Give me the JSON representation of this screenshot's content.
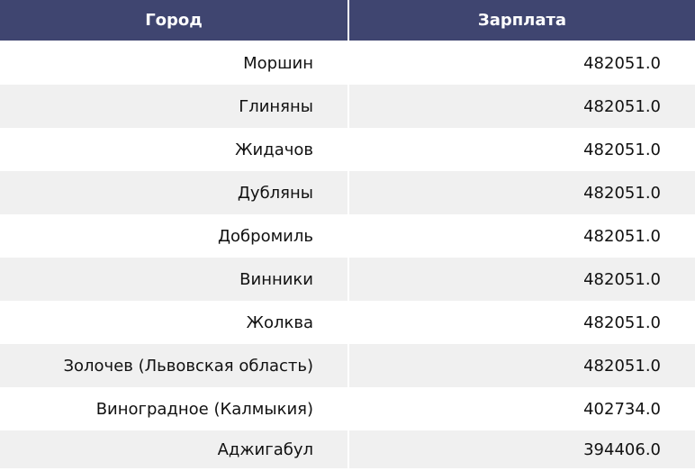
{
  "chart_data": {
    "type": "table",
    "columns": [
      "Город",
      "Зарплата"
    ],
    "rows": [
      [
        "Моршин",
        "482051.0"
      ],
      [
        "Глиняны",
        "482051.0"
      ],
      [
        "Жидачов",
        "482051.0"
      ],
      [
        "Дубляны",
        "482051.0"
      ],
      [
        "Добромиль",
        "482051.0"
      ],
      [
        "Винники",
        "482051.0"
      ],
      [
        "Жолква",
        "482051.0"
      ],
      [
        "Золочев (Львовская область)",
        "482051.0"
      ],
      [
        "Виноградное (Калмыкия)",
        "402734.0"
      ],
      [
        "Аджигабул",
        "394406.0"
      ]
    ]
  },
  "colors": {
    "header_bg": "#3f4570",
    "header_text": "#ffffff",
    "row_alt_bg": "#f0f0f0",
    "row_bg": "#ffffff"
  }
}
